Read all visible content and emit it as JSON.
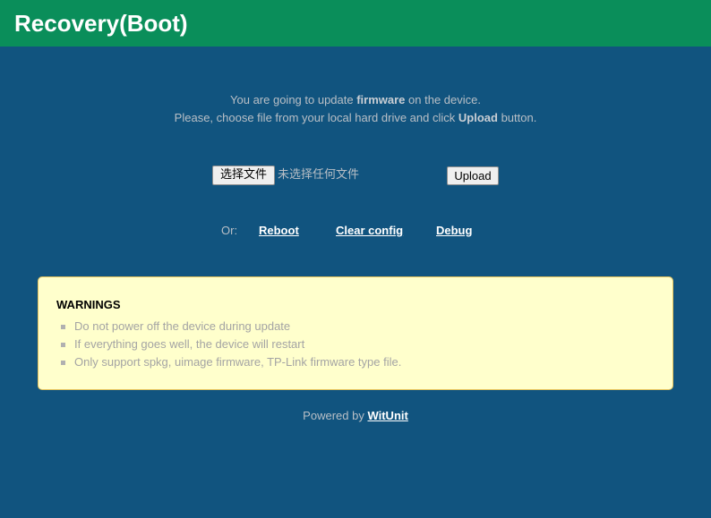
{
  "header": {
    "title": "Recovery(Boot)",
    "color": "#0a8e5a"
  },
  "intro": {
    "line1_pre": "You are going to update ",
    "line1_bold": "firmware",
    "line1_post": " on the device.",
    "line2_pre": "Please, choose file from your local hard drive and click ",
    "line2_bold": "Upload",
    "line2_post": " button."
  },
  "upload_form": {
    "choose_file_label": "选择文件",
    "file_status": "未选择任何文件",
    "upload_label": "Upload"
  },
  "actions": {
    "or_label": "Or:",
    "reboot": "Reboot",
    "clear_config": "Clear config",
    "debug": "Debug"
  },
  "warnings": {
    "title": "WARNINGS",
    "items": [
      "Do not power off the device during update",
      "If everything goes well, the device will restart",
      "Only support spkg, uimage firmware, TP-Link firmware type file."
    ]
  },
  "footer": {
    "powered_by": "Powered by",
    "brand": "WitUnit"
  },
  "colors": {
    "background": "#11547f",
    "warning_bg": "#ffffcc"
  }
}
